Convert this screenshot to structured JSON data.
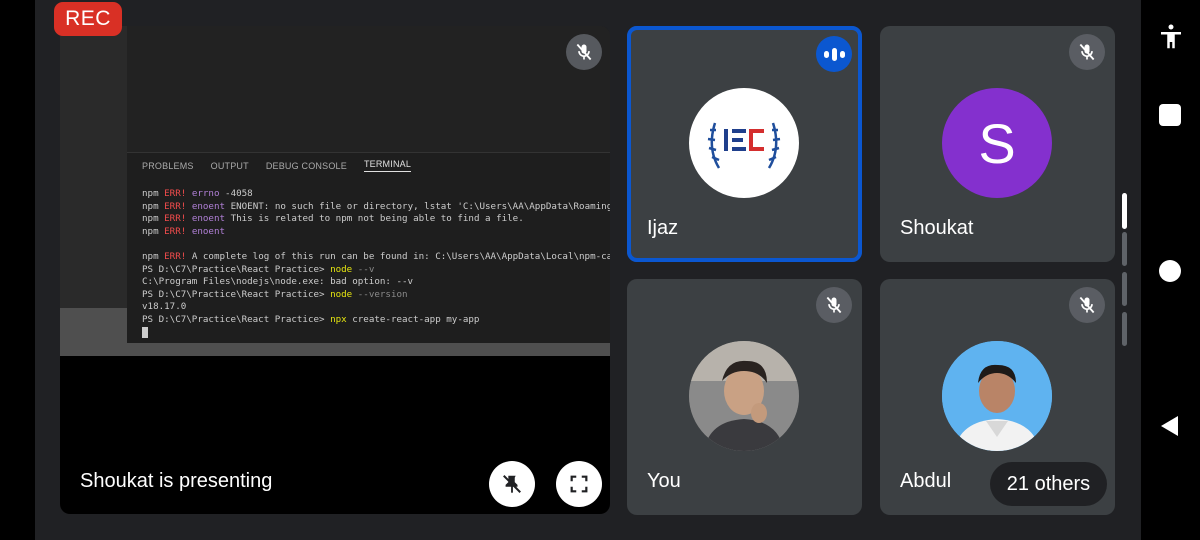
{
  "recording": {
    "label": "REC"
  },
  "presentation": {
    "label": "Shoukat is presenting",
    "panel_tabs": [
      "PROBLEMS",
      "OUTPUT",
      "DEBUG CONSOLE",
      "TERMINAL"
    ],
    "active_tab": "TERMINAL",
    "terminal_lines": [
      [
        {
          "t": "npm ",
          "c": ""
        },
        {
          "t": "ERR!",
          "c": "t-red"
        },
        {
          "t": " ",
          "c": ""
        },
        {
          "t": "errno",
          "c": "t-purple"
        },
        {
          "t": " -4058",
          "c": ""
        }
      ],
      [
        {
          "t": "npm ",
          "c": ""
        },
        {
          "t": "ERR!",
          "c": "t-red"
        },
        {
          "t": " ",
          "c": ""
        },
        {
          "t": "enoent",
          "c": "t-purple"
        },
        {
          "t": " ENOENT: no such file or directory, lstat 'C:\\Users\\AA\\AppData\\Roaming\\npm'",
          "c": ""
        }
      ],
      [
        {
          "t": "npm ",
          "c": ""
        },
        {
          "t": "ERR!",
          "c": "t-red"
        },
        {
          "t": " ",
          "c": ""
        },
        {
          "t": "enoent",
          "c": "t-purple"
        },
        {
          "t": " This is related to npm not being able to find a file.",
          "c": ""
        }
      ],
      [
        {
          "t": "npm ",
          "c": ""
        },
        {
          "t": "ERR!",
          "c": "t-red"
        },
        {
          "t": " ",
          "c": ""
        },
        {
          "t": "enoent",
          "c": "t-purple"
        }
      ],
      [],
      [
        {
          "t": "npm ",
          "c": ""
        },
        {
          "t": "ERR!",
          "c": "t-red"
        },
        {
          "t": " A complete log of this run can be found in: C:\\Users\\AA\\AppData\\Local\\npm-cache\\_",
          "c": ""
        }
      ],
      [
        {
          "t": "PS D:\\C7\\Practice\\React Practice> ",
          "c": ""
        },
        {
          "t": "node",
          "c": "t-yellow"
        },
        {
          "t": " --v",
          "c": "t-gray"
        }
      ],
      [
        {
          "t": "C:\\Program Files\\nodejs\\node.exe: bad option: --v",
          "c": ""
        }
      ],
      [
        {
          "t": "PS D:\\C7\\Practice\\React Practice> ",
          "c": ""
        },
        {
          "t": "node",
          "c": "t-yellow"
        },
        {
          "t": " --version",
          "c": "t-gray"
        }
      ],
      [
        {
          "t": "v18.17.0",
          "c": ""
        }
      ],
      [
        {
          "t": "PS D:\\C7\\Practice\\React Practice> ",
          "c": ""
        },
        {
          "t": "npx",
          "c": "t-yellow"
        },
        {
          "t": " create-react-app my-app",
          "c": ""
        }
      ]
    ]
  },
  "participants": {
    "ijaz": {
      "name": "Ijaz",
      "logo_text": "IEC"
    },
    "shoukat": {
      "name": "Shoukat",
      "initial": "S"
    },
    "you": {
      "name": "You"
    },
    "abdul": {
      "name": "Abdul"
    }
  },
  "others": {
    "label": "21 others"
  },
  "colors": {
    "rec": "#d93025",
    "speaking": "#0b57d0",
    "avatar_s": "#8430ce",
    "tile": "#3c4043",
    "stage": "#202124"
  }
}
